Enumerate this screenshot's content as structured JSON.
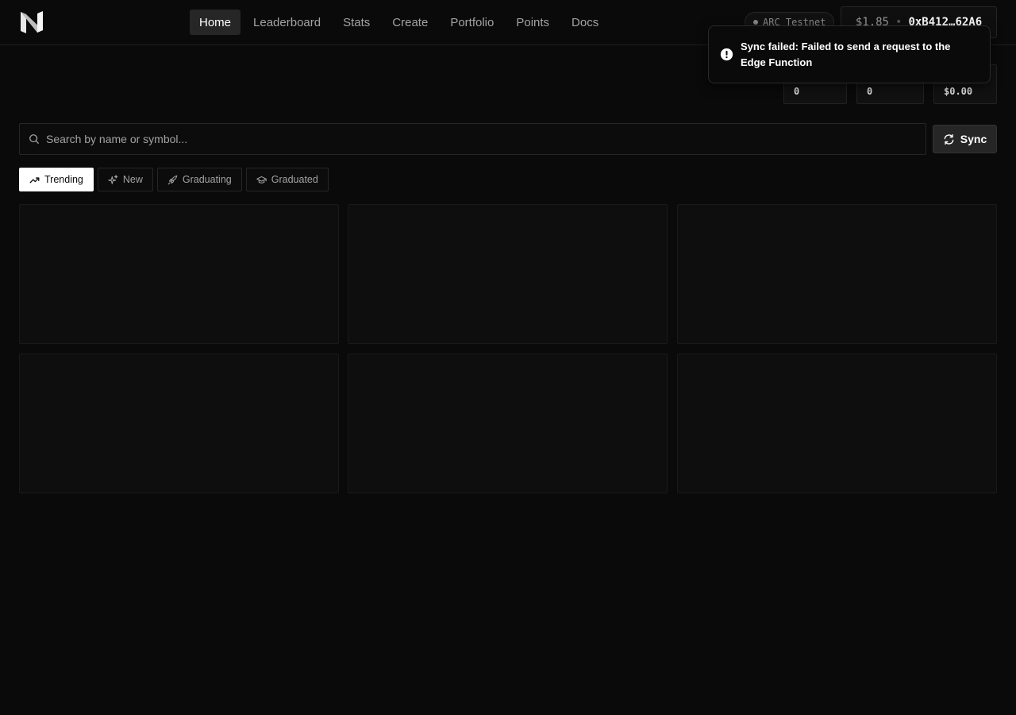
{
  "nav": {
    "items": [
      {
        "label": "Home",
        "active": true
      },
      {
        "label": "Leaderboard",
        "active": false
      },
      {
        "label": "Stats",
        "active": false
      },
      {
        "label": "Create",
        "active": false
      },
      {
        "label": "Portfolio",
        "active": false
      },
      {
        "label": "Points",
        "active": false
      },
      {
        "label": "Docs",
        "active": false
      }
    ]
  },
  "network": {
    "label": "ARC Testnet",
    "icon": "status-dot"
  },
  "wallet": {
    "balance": "$1.85",
    "separator": "•",
    "address": "0xB412…62A6"
  },
  "stats": [
    {
      "value": "0"
    },
    {
      "value": "0"
    },
    {
      "value": "$0.00"
    }
  ],
  "toast": {
    "icon": "alert-circle-icon",
    "message": "Sync failed: Failed to send a request to the Edge Function"
  },
  "search": {
    "placeholder": "Search by name or symbol...",
    "value": ""
  },
  "sync_button": {
    "label": "Sync",
    "icon": "refresh-icon"
  },
  "filters": [
    {
      "label": "Trending",
      "icon": "trending-up-icon",
      "active": true
    },
    {
      "label": "New",
      "icon": "sparkles-icon",
      "active": false
    },
    {
      "label": "Graduating",
      "icon": "rocket-icon",
      "active": false
    },
    {
      "label": "Graduated",
      "icon": "graduation-cap-icon",
      "active": false
    }
  ],
  "colors": {
    "background": "#0a0a0a",
    "active_nav": "#262626",
    "active_filter": "#ffffff"
  }
}
